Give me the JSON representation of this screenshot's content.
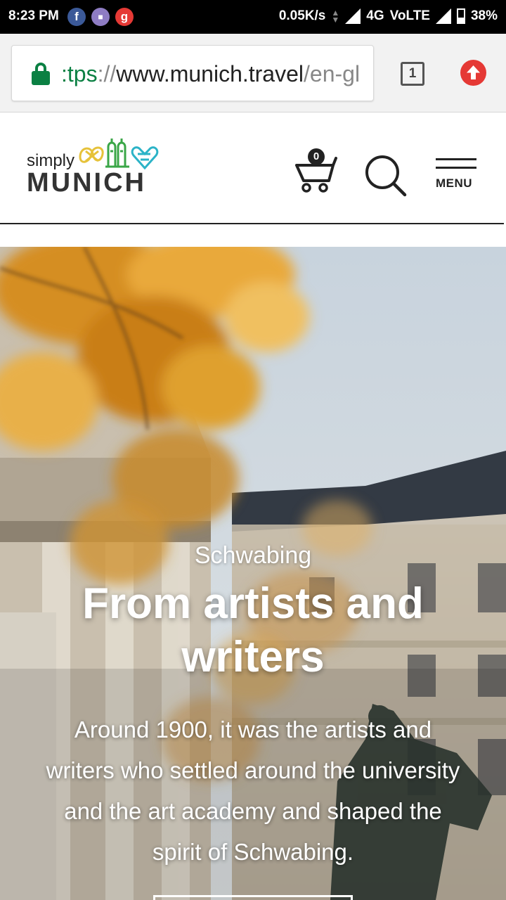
{
  "status_bar": {
    "time": "8:23 PM",
    "notifications": [
      {
        "icon": "facebook-icon",
        "glyph": "f",
        "color": "#3b5998"
      },
      {
        "icon": "messenger-app-icon",
        "glyph": "■",
        "color": "#8e7cc3"
      },
      {
        "icon": "g-app-icon",
        "glyph": "g",
        "color": "#e53935"
      }
    ],
    "net_speed": "0.05K/s",
    "network": "4G",
    "volte": "VoLTE",
    "battery": "38%"
  },
  "browser": {
    "url_proto": ":tps",
    "url_sep": "://",
    "url_host": "www.munich.travel",
    "url_path": "/en-gl",
    "tab_count": "1",
    "secure_color": "#0b8043",
    "update_color": "#e53935"
  },
  "site_header": {
    "logo_small": "simply",
    "logo_large": "MUNICH",
    "cart_count": "0",
    "menu_label": "MENU"
  },
  "hero": {
    "kicker": "Schwabing",
    "title": "From artists and writers",
    "body": "Around 1900, it was the artists and writers who settled around the university and the art academy and shaped the spirit of Schwabing."
  }
}
